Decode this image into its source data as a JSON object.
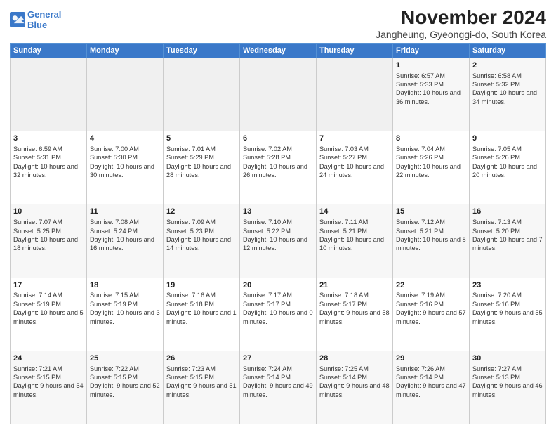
{
  "logo": {
    "line1": "General",
    "line2": "Blue"
  },
  "title": "November 2024",
  "subtitle": "Jangheung, Gyeonggi-do, South Korea",
  "weekdays": [
    "Sunday",
    "Monday",
    "Tuesday",
    "Wednesday",
    "Thursday",
    "Friday",
    "Saturday"
  ],
  "weeks": [
    [
      {
        "day": "",
        "text": ""
      },
      {
        "day": "",
        "text": ""
      },
      {
        "day": "",
        "text": ""
      },
      {
        "day": "",
        "text": ""
      },
      {
        "day": "",
        "text": ""
      },
      {
        "day": "1",
        "text": "Sunrise: 6:57 AM\nSunset: 5:33 PM\nDaylight: 10 hours and 36 minutes."
      },
      {
        "day": "2",
        "text": "Sunrise: 6:58 AM\nSunset: 5:32 PM\nDaylight: 10 hours and 34 minutes."
      }
    ],
    [
      {
        "day": "3",
        "text": "Sunrise: 6:59 AM\nSunset: 5:31 PM\nDaylight: 10 hours and 32 minutes."
      },
      {
        "day": "4",
        "text": "Sunrise: 7:00 AM\nSunset: 5:30 PM\nDaylight: 10 hours and 30 minutes."
      },
      {
        "day": "5",
        "text": "Sunrise: 7:01 AM\nSunset: 5:29 PM\nDaylight: 10 hours and 28 minutes."
      },
      {
        "day": "6",
        "text": "Sunrise: 7:02 AM\nSunset: 5:28 PM\nDaylight: 10 hours and 26 minutes."
      },
      {
        "day": "7",
        "text": "Sunrise: 7:03 AM\nSunset: 5:27 PM\nDaylight: 10 hours and 24 minutes."
      },
      {
        "day": "8",
        "text": "Sunrise: 7:04 AM\nSunset: 5:26 PM\nDaylight: 10 hours and 22 minutes."
      },
      {
        "day": "9",
        "text": "Sunrise: 7:05 AM\nSunset: 5:26 PM\nDaylight: 10 hours and 20 minutes."
      }
    ],
    [
      {
        "day": "10",
        "text": "Sunrise: 7:07 AM\nSunset: 5:25 PM\nDaylight: 10 hours and 18 minutes."
      },
      {
        "day": "11",
        "text": "Sunrise: 7:08 AM\nSunset: 5:24 PM\nDaylight: 10 hours and 16 minutes."
      },
      {
        "day": "12",
        "text": "Sunrise: 7:09 AM\nSunset: 5:23 PM\nDaylight: 10 hours and 14 minutes."
      },
      {
        "day": "13",
        "text": "Sunrise: 7:10 AM\nSunset: 5:22 PM\nDaylight: 10 hours and 12 minutes."
      },
      {
        "day": "14",
        "text": "Sunrise: 7:11 AM\nSunset: 5:21 PM\nDaylight: 10 hours and 10 minutes."
      },
      {
        "day": "15",
        "text": "Sunrise: 7:12 AM\nSunset: 5:21 PM\nDaylight: 10 hours and 8 minutes."
      },
      {
        "day": "16",
        "text": "Sunrise: 7:13 AM\nSunset: 5:20 PM\nDaylight: 10 hours and 7 minutes."
      }
    ],
    [
      {
        "day": "17",
        "text": "Sunrise: 7:14 AM\nSunset: 5:19 PM\nDaylight: 10 hours and 5 minutes."
      },
      {
        "day": "18",
        "text": "Sunrise: 7:15 AM\nSunset: 5:19 PM\nDaylight: 10 hours and 3 minutes."
      },
      {
        "day": "19",
        "text": "Sunrise: 7:16 AM\nSunset: 5:18 PM\nDaylight: 10 hours and 1 minute."
      },
      {
        "day": "20",
        "text": "Sunrise: 7:17 AM\nSunset: 5:17 PM\nDaylight: 10 hours and 0 minutes."
      },
      {
        "day": "21",
        "text": "Sunrise: 7:18 AM\nSunset: 5:17 PM\nDaylight: 9 hours and 58 minutes."
      },
      {
        "day": "22",
        "text": "Sunrise: 7:19 AM\nSunset: 5:16 PM\nDaylight: 9 hours and 57 minutes."
      },
      {
        "day": "23",
        "text": "Sunrise: 7:20 AM\nSunset: 5:16 PM\nDaylight: 9 hours and 55 minutes."
      }
    ],
    [
      {
        "day": "24",
        "text": "Sunrise: 7:21 AM\nSunset: 5:15 PM\nDaylight: 9 hours and 54 minutes."
      },
      {
        "day": "25",
        "text": "Sunrise: 7:22 AM\nSunset: 5:15 PM\nDaylight: 9 hours and 52 minutes."
      },
      {
        "day": "26",
        "text": "Sunrise: 7:23 AM\nSunset: 5:15 PM\nDaylight: 9 hours and 51 minutes."
      },
      {
        "day": "27",
        "text": "Sunrise: 7:24 AM\nSunset: 5:14 PM\nDaylight: 9 hours and 49 minutes."
      },
      {
        "day": "28",
        "text": "Sunrise: 7:25 AM\nSunset: 5:14 PM\nDaylight: 9 hours and 48 minutes."
      },
      {
        "day": "29",
        "text": "Sunrise: 7:26 AM\nSunset: 5:14 PM\nDaylight: 9 hours and 47 minutes."
      },
      {
        "day": "30",
        "text": "Sunrise: 7:27 AM\nSunset: 5:13 PM\nDaylight: 9 hours and 46 minutes."
      }
    ]
  ]
}
